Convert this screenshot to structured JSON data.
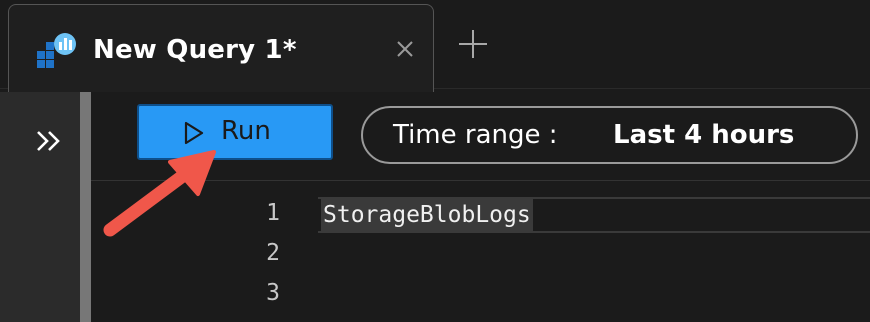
{
  "tab": {
    "title": "New Query 1*",
    "icon": "log-analytics-icon",
    "close_icon": "close-icon",
    "new_tab_icon": "plus-icon"
  },
  "sidebar": {
    "expand_icon": "double-chevron-right-icon"
  },
  "toolbar": {
    "run_label": "Run",
    "run_icon": "play-icon",
    "time_range_label": "Time range :",
    "time_range_value": "Last 4 hours"
  },
  "editor": {
    "lines": [
      {
        "number": "1",
        "text": "StorageBlobLogs"
      },
      {
        "number": "2",
        "text": ""
      },
      {
        "number": "3",
        "text": ""
      }
    ]
  },
  "annotation": {
    "arrow_color": "#f0574a"
  },
  "colors": {
    "accent": "#2899f5",
    "background": "#1b1b1b"
  }
}
